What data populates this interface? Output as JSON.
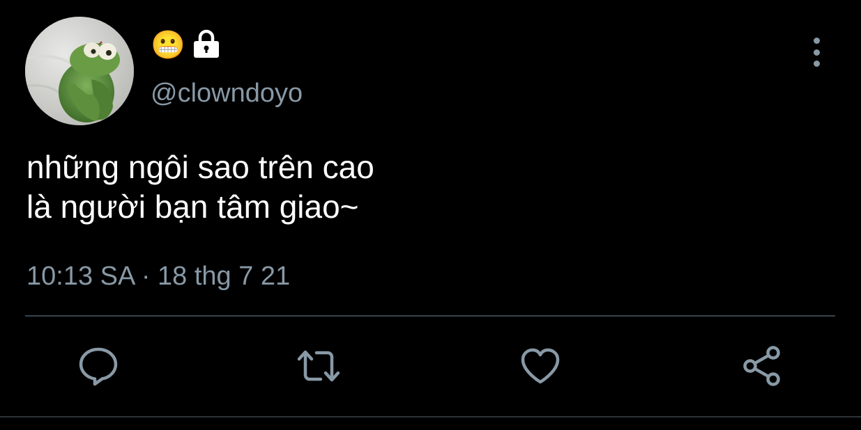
{
  "user": {
    "display_emoji": "😬",
    "handle": "@clowndoyo",
    "protected_icon": "lock-icon",
    "avatar_icon": "avatar-image"
  },
  "tweet": {
    "lines": [
      "những ngôi sao trên cao",
      "là người bạn tâm giao~"
    ],
    "time": "10:13 SA",
    "separator": "·",
    "date": "18 thg 7 21"
  },
  "actions": [
    {
      "name": "reply",
      "icon": "comment-icon"
    },
    {
      "name": "retweet",
      "icon": "retweet-icon"
    },
    {
      "name": "like",
      "icon": "heart-icon"
    },
    {
      "name": "share",
      "icon": "share-icon"
    }
  ],
  "colors": {
    "background": "#000000",
    "text": "#ffffff",
    "secondary": "#8899a6",
    "divider": "#38444d",
    "icon": "#8899a6"
  }
}
